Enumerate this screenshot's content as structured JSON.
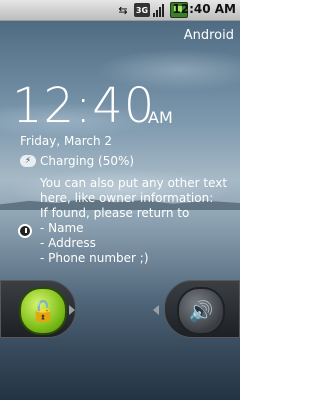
{
  "status_bar": {
    "icons": [
      "usb-icon",
      "3g-icon",
      "signal-icon",
      "battery-charging-icon"
    ],
    "net_label": "3G",
    "time": "12:40 AM"
  },
  "carrier": "Android",
  "lockscreen": {
    "clock": "12:40",
    "ampm": "AM",
    "date": "Friday, March 2",
    "charging": "Charging (50%)",
    "owner_lines": [
      "You can also put any other text",
      "here, like owner information:",
      "If found, please return to",
      "- Name",
      "- Address",
      "- Phone number ;)"
    ],
    "unlock_icon": "padlock-icon",
    "sound_icon": "speaker-icon"
  }
}
